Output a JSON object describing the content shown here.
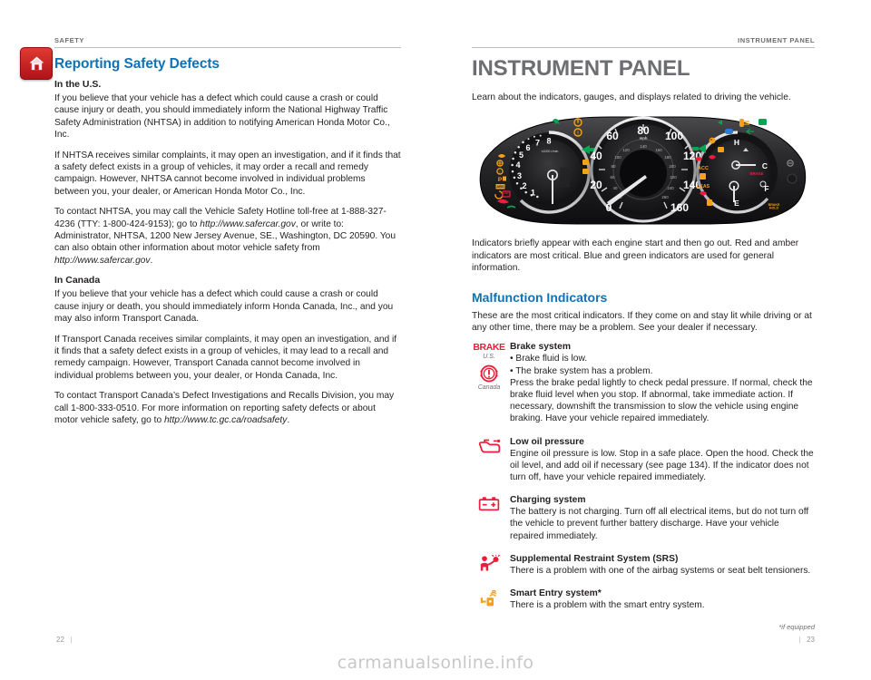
{
  "colors": {
    "accent_blue": "#0f72b5",
    "chapter_gray": "#6d6e71",
    "red": "#ed1c3a",
    "amber": "#f7a11a",
    "home_red": "#c2161c",
    "rule_gray": "#bcbec0",
    "watermark_gray": "#c7c8ca"
  },
  "watermark": "carmanualsonline.info",
  "left_page": {
    "running_head": "SAFETY",
    "home_icon": "home-icon",
    "folio": "22",
    "title": "Reporting Safety Defects",
    "sections": [
      {
        "heading": "In the U.S.",
        "paragraphs": [
          "If you believe that your vehicle has a defect which could cause a crash or could cause injury or death, you should immediately inform the National Highway Traffic Safety Administration (NHTSA) in addition to notifying American Honda Motor Co., Inc.",
          "If NHTSA receives similar complaints, it may open an investigation, and if it finds that a safety defect exists in a group of vehicles, it may order a recall and remedy campaign. However, NHTSA cannot become involved in individual problems between you, your dealer, or American Honda Motor Co., Inc."
        ],
        "contact_paragraph": {
          "part1": "To contact NHTSA, you may call the Vehicle Safety Hotline toll-free at 1-888-327-4236 (TTY: 1-800-424-9153); go to ",
          "url1": "http://www.safercar.gov",
          "part2": ", or write to: Administrator, NHTSA, 1200 New Jersey Avenue, SE., Washington, DC 20590. You can also obtain other information about motor vehicle safety from ",
          "url2": "http://www.safercar.gov",
          "part3": "."
        }
      },
      {
        "heading": "In Canada",
        "paragraphs": [
          "If you believe that your vehicle has a defect which could cause a crash or could cause injury or death, you should immediately inform Honda Canada, Inc., and you may also inform Transport Canada.",
          "If Transport Canada receives similar complaints, it may open an investigation, and if it finds that a safety defect exists in a group of vehicles, it may lead to a recall and remedy campaign. However, Transport Canada cannot become involved in individual problems between you, your dealer, or Honda Canada, Inc."
        ],
        "contact_paragraph": {
          "part1": "To contact Transport Canada’s Defect Investigations and Recalls Division, you may call 1-800-333-0510. For more information on reporting safety defects or about motor vehicle safety, go to ",
          "url1": "http://www.tc.gc.ca/roadsafety",
          "part2": ".",
          "url2": "",
          "part3": ""
        }
      }
    ]
  },
  "right_page": {
    "running_head": "INSTRUMENT PANEL",
    "folio": "23",
    "chapter_title": "INSTRUMENT PANEL",
    "intro": "Learn about the indicators, gauges, and displays related to driving the vehicle.",
    "figure_caption_paragraph": "Indicators briefly appear with each engine start and then go out. Red and amber indicators are most critical. Blue and green indicators are used for general information.",
    "section_heading": "Malfunction Indicators",
    "section_intro": "These are the most critical indicators. If they come on and stay lit while driving or at any other time, there may be a problem. See your dealer if necessary.",
    "footnote": "*if equipped",
    "indicators": [
      {
        "icon": "brake-system-icon",
        "icon_text_us": "BRAKE",
        "icon_caption_us": "U.S.",
        "icon_caption_ca": "Canada",
        "title": "Brake system",
        "bullets": [
          "• Brake fluid is low.",
          "• The brake system has a problem."
        ],
        "text": "Press the brake pedal lightly to check pedal pressure. If normal, check the brake fluid level when you stop. If abnormal, take immediate action. If necessary, downshift the transmission to slow the vehicle using engine braking. Have your vehicle repaired immediately."
      },
      {
        "icon": "low-oil-pressure-icon",
        "title": "Low oil pressure",
        "bullets": [],
        "text": "Engine oil pressure is low. Stop in a safe place. Open the hood. Check the oil level, and add oil if necessary (see page 134). If the indicator does not turn off, have your vehicle repaired immediately."
      },
      {
        "icon": "charging-system-icon",
        "title": "Charging system",
        "bullets": [],
        "text": "The battery is not charging. Turn off all electrical items, but do not turn off the vehicle to prevent further battery discharge. Have your vehicle repaired immediately."
      },
      {
        "icon": "srs-airbag-icon",
        "title": "Supplemental Restraint System (SRS)",
        "bullets": [],
        "text": "There is a problem with one of the airbag systems or seat belt tensioners."
      },
      {
        "icon": "smart-entry-icon",
        "title": "Smart Entry system*",
        "bullets": [],
        "text": "There is a problem with the smart entry system."
      }
    ],
    "instrument_cluster": {
      "tachometer": {
        "label": "x1000 r/min",
        "ticks": [
          "1",
          "2",
          "3",
          "4",
          "5",
          "6",
          "7",
          "8"
        ]
      },
      "speedometer": {
        "unit_primary": "mph",
        "unit_secondary": "km/h",
        "mph_ticks": [
          "0",
          "20",
          "40",
          "60",
          "80",
          "100",
          "120",
          "140",
          "160"
        ],
        "kmh_ticks": [
          "20",
          "40",
          "60",
          "80",
          "100",
          "120",
          "140",
          "160",
          "180",
          "200",
          "220",
          "240",
          "260"
        ]
      },
      "temp_gauge": {
        "hot": "H",
        "cold": "C"
      },
      "fuel_gauge": {
        "full": "F",
        "empty": "E"
      },
      "labels": [
        "ACC",
        "LKAS",
        "BRAKE"
      ]
    }
  }
}
